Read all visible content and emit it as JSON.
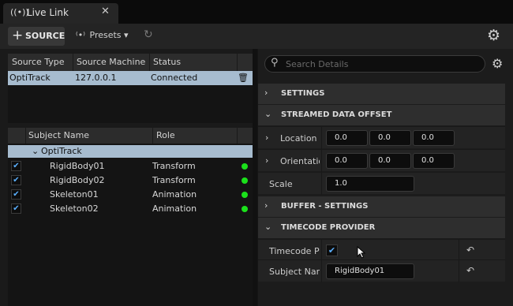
{
  "tab": {
    "icon": "live-link-icon",
    "title": "Live Link",
    "close": "✕"
  },
  "toolbar": {
    "source_label": "SOURCE",
    "presets_label": "Presets",
    "presets_caret": "▾"
  },
  "sources": {
    "columns": [
      "Source Type",
      "Source Machine",
      "Status"
    ],
    "rows": [
      {
        "type": "OptiTrack",
        "machine": "127.0.0.1",
        "status": "Connected"
      }
    ]
  },
  "subjects": {
    "columns": [
      "Subject Name",
      "Role"
    ],
    "group": "OptiTrack",
    "rows": [
      {
        "name": "RigidBody01",
        "role": "Transform",
        "enabled": true,
        "status_color": "#1be11b"
      },
      {
        "name": "RigidBody02",
        "role": "Transform",
        "enabled": true,
        "status_color": "#1be11b"
      },
      {
        "name": "Skeleton01",
        "role": "Animation",
        "enabled": true,
        "status_color": "#1be11b"
      },
      {
        "name": "Skeleton02",
        "role": "Animation",
        "enabled": true,
        "status_color": "#1be11b"
      }
    ]
  },
  "details": {
    "search_placeholder": "Search Details",
    "categories": {
      "settings": "SETTINGS",
      "streamed_offset": "STREAMED DATA OFFSET",
      "buffer": "BUFFER - SETTINGS",
      "timecode": "TIMECODE PROVIDER"
    },
    "location": {
      "label": "Location",
      "x": "0.0",
      "y": "0.0",
      "z": "0.0"
    },
    "orientation": {
      "label": "Orientation",
      "x": "0.0",
      "y": "0.0",
      "z": "0.0"
    },
    "scale": {
      "label": "Scale",
      "value": "1.0"
    },
    "timecode_provider": {
      "label": "Timecode Pro",
      "checked": true
    },
    "subject_name": {
      "label": "Subject Name",
      "value": "RigidBody01"
    }
  },
  "colors": {
    "selection": "#a7bccf",
    "status_live": "#1be11b",
    "checkbox_accent": "#5bb0ff"
  }
}
